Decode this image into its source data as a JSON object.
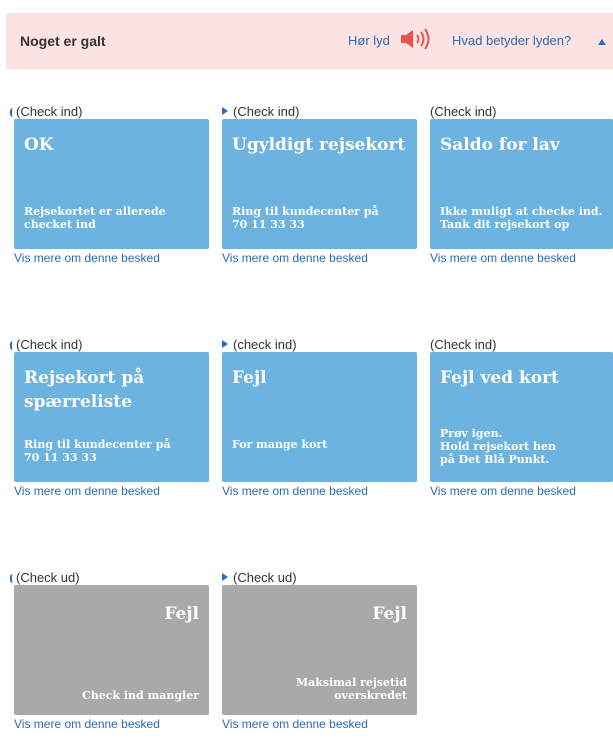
{
  "header": {
    "title": "Noget er galt",
    "listen_label": "Hør lyd",
    "meaning_label": "Hvad betyder lyden?"
  },
  "colors": {
    "blue_card": "#6cb4df",
    "gray_card": "#a9a9a9",
    "link": "#2a6bb6",
    "header_bg": "#fbe3e3"
  },
  "cards": [
    {
      "caption": "(Check ind)",
      "title": "OK",
      "message": [
        "Rejsekortet er allerede",
        "checket ind"
      ],
      "link": "Vis mere om denne besked",
      "style": "blue"
    },
    {
      "caption": "(Check ind)",
      "title": "Ugyldigt rejsekort",
      "message": [
        "Ring til kundecenter på",
        "70 11 33 33"
      ],
      "link": "Vis mere om denne besked",
      "style": "blue"
    },
    {
      "caption": "(Check ind)",
      "title": "Saldo for lav",
      "message": [
        "Ikke muligt at checke ind.",
        "Tank dit rejsekort op"
      ],
      "link": "Vis mere om denne besked",
      "style": "blue"
    },
    {
      "caption": "(Check ind)",
      "title": [
        "Rejsekort på",
        "spærreliste"
      ],
      "message": [
        "Ring til kundecenter på",
        "70 11 33 33"
      ],
      "link": "Vis mere om denne besked",
      "style": "blue"
    },
    {
      "caption": "(check ind)",
      "title": "Fejl",
      "message": [
        "For mange kort"
      ],
      "link": "Vis mere om denne besked",
      "style": "blue"
    },
    {
      "caption": "(Check ind)",
      "title": "Fejl ved kort",
      "message": [
        "Prøv igen.",
        "Hold rejsekort hen",
        "på Det Blå Punkt."
      ],
      "link": "Vis mere om denne besked",
      "style": "blue"
    },
    {
      "caption": "(Check ud)",
      "title": "Fejl",
      "message": [
        "Check ind mangler"
      ],
      "link": "Vis mere om denne besked",
      "style": "gray"
    },
    {
      "caption": "(Check ud)",
      "title": "Fejl",
      "message": [
        "Maksimal rejsetid",
        "overskredet"
      ],
      "link": "Vis mere om denne besked",
      "style": "gray"
    }
  ]
}
